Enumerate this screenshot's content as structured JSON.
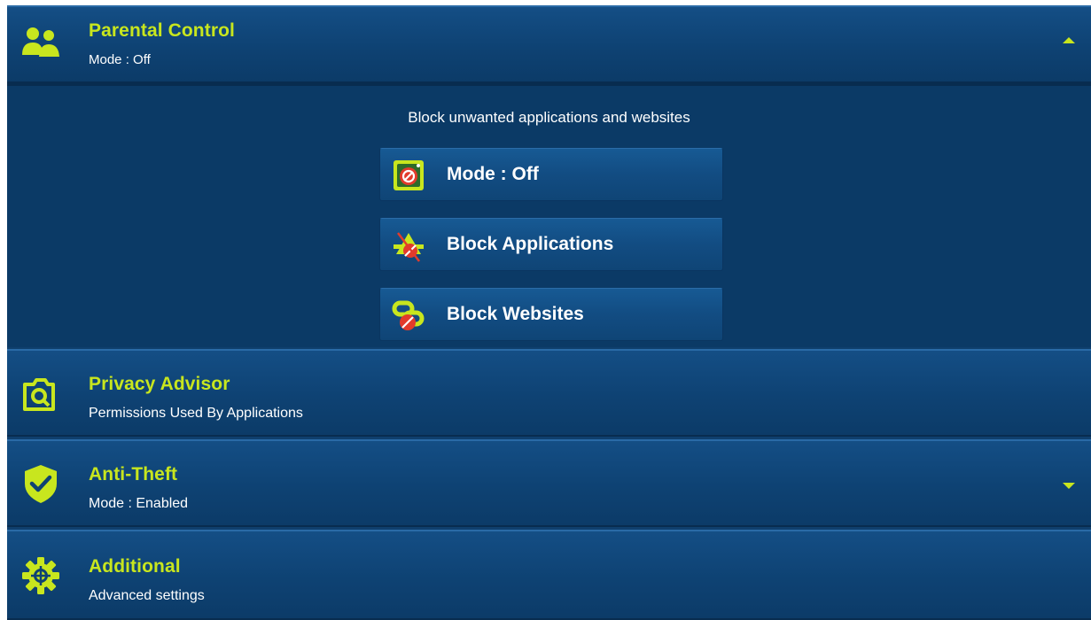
{
  "parental_control": {
    "title": "Parental Control",
    "subtitle": "Mode : Off",
    "expanded": true,
    "description": "Block unwanted applications and websites",
    "buttons": [
      {
        "label": "Mode : Off",
        "icon": "mode-off-icon"
      },
      {
        "label": "Block Applications",
        "icon": "block-applications-icon"
      },
      {
        "label": "Block Websites",
        "icon": "block-websites-icon"
      }
    ]
  },
  "privacy_advisor": {
    "title": "Privacy Advisor",
    "subtitle": "Permissions Used By Applications",
    "icon": "camera-icon"
  },
  "anti_theft": {
    "title": "Anti-Theft",
    "subtitle": "Mode : Enabled",
    "icon": "shield-check-icon",
    "expanded": false
  },
  "additional": {
    "title": "Additional",
    "subtitle": "Advanced settings",
    "icon": "gear-icon"
  },
  "colors": {
    "accent": "#c8e61e",
    "background": "#0f3f6d",
    "text": "#ffffff"
  }
}
